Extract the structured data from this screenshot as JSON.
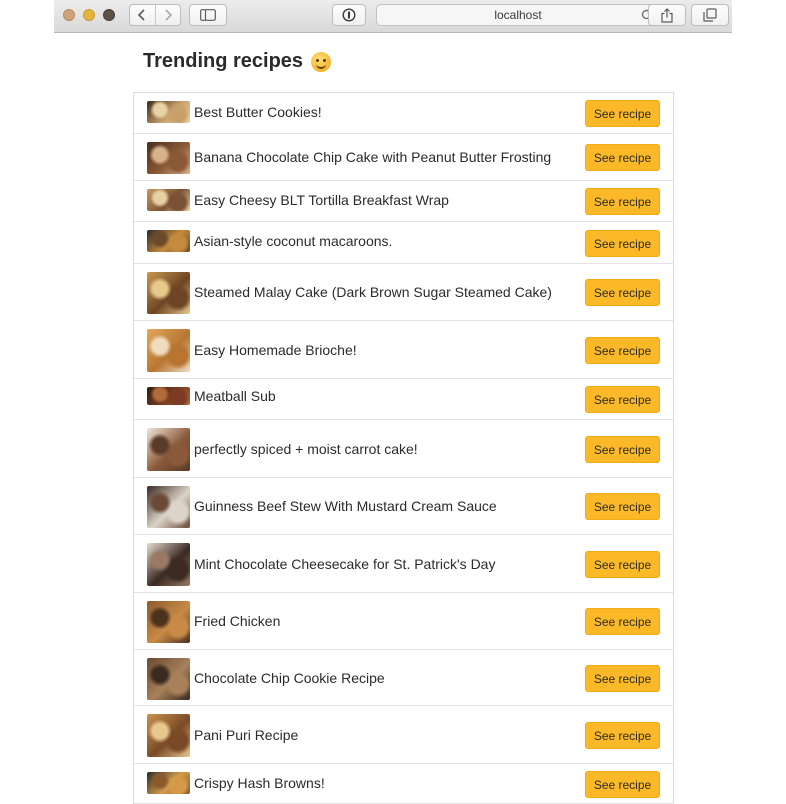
{
  "browser": {
    "url": "localhost",
    "toolbar_icons": [
      "back-arrow-icon",
      "forward-arrow-icon",
      "sidebar-icon",
      "password-icon",
      "reload-icon",
      "share-icon",
      "tabs-icon"
    ]
  },
  "page": {
    "title": "Trending recipes",
    "title_emoji": "smiling-face-icon",
    "button_color": "#fbb928"
  },
  "recipes": [
    {
      "title": "Best Butter Cookies!",
      "button_label": "See recipe",
      "image": "butter-cookies-thumbnail",
      "tones": [
        "#3a2a1c",
        "#c9a06a",
        "#e8d2a6"
      ]
    },
    {
      "title": "Banana Chocolate Chip Cake with Peanut Butter Frosting",
      "button_label": "See recipe",
      "image": "banana-cake-thumbnail",
      "tones": [
        "#4a2d1a",
        "#8a5a36",
        "#d9b28a"
      ]
    },
    {
      "title": "Easy Cheesy BLT Tortilla Breakfast Wrap",
      "button_label": "See recipe",
      "image": "blt-wrap-thumbnail",
      "tones": [
        "#c49a5c",
        "#7a5234",
        "#e6cfa4"
      ]
    },
    {
      "title": "Asian-style coconut macaroons.",
      "button_label": "See recipe",
      "image": "coconut-macaroons-thumbnail",
      "tones": [
        "#2d2a26",
        "#c58a3d",
        "#6b4a2a"
      ]
    },
    {
      "title": "Steamed Malay Cake (Dark Brown Sugar Steamed Cake)",
      "button_label": "See recipe",
      "image": "malay-cake-thumbnail",
      "tones": [
        "#c9984e",
        "#6e4524",
        "#e7c98b"
      ]
    },
    {
      "title": "Easy Homemade Brioche!",
      "button_label": "See recipe",
      "image": "brioche-thumbnail",
      "tones": [
        "#e0a85a",
        "#b87532",
        "#f1dcc0"
      ]
    },
    {
      "title": "Meatball Sub",
      "button_label": "See recipe",
      "image": "meatball-sub-thumbnail",
      "tones": [
        "#2e1d14",
        "#7c3b22",
        "#b26a3a"
      ]
    },
    {
      "title": "perfectly spiced + moist carrot cake!",
      "button_label": "See recipe",
      "image": "carrot-cake-thumbnail",
      "tones": [
        "#f0e6d8",
        "#8a5a3a",
        "#5a3a28"
      ]
    },
    {
      "title": "Guinness Beef Stew With Mustard Cream Sauce",
      "button_label": "See recipe",
      "image": "beef-stew-thumbnail",
      "tones": [
        "#3a2a22",
        "#dcd4c8",
        "#6a4a36"
      ]
    },
    {
      "title": "Mint Chocolate Cheesecake for St. Patrick's Day",
      "button_label": "See recipe",
      "image": "mint-cheesecake-thumbnail",
      "tones": [
        "#e6dccf",
        "#3a2a22",
        "#9a7a62"
      ]
    },
    {
      "title": "Fried Chicken",
      "button_label": "See recipe",
      "image": "fried-chicken-thumbnail",
      "tones": [
        "#8a5a2e",
        "#c98a46",
        "#4a321e"
      ]
    },
    {
      "title": "Chocolate Chip Cookie Recipe",
      "button_label": "See recipe",
      "image": "chocolate-chip-cookie-thumbnail",
      "tones": [
        "#6a4a34",
        "#a8805a",
        "#3a2a20"
      ]
    },
    {
      "title": "Pani Puri Recipe",
      "button_label": "See recipe",
      "image": "pani-puri-thumbnail",
      "tones": [
        "#c8924e",
        "#7a4a26",
        "#e8c88e"
      ]
    },
    {
      "title": "Crispy Hash Browns!",
      "button_label": "See recipe",
      "image": "hash-browns-thumbnail",
      "tones": [
        "#2a2a2a",
        "#d49a4a",
        "#8a5a2a"
      ]
    }
  ]
}
